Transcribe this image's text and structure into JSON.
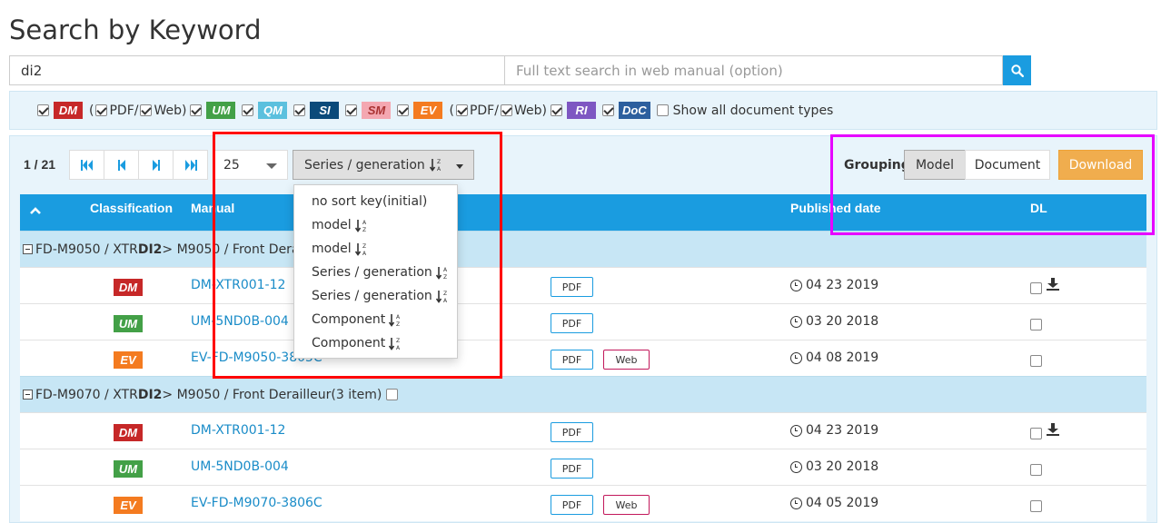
{
  "page": {
    "title": "Search by Keyword"
  },
  "search": {
    "keyword_value": "di2",
    "fulltext_placeholder": "Full text search in web manual (option)",
    "search_icon": "search-icon"
  },
  "filters": {
    "items": [
      {
        "code": "DM",
        "color": "#c62828",
        "checked": true
      },
      {
        "code": "UM",
        "color": "#43a047",
        "checked": true
      },
      {
        "code": "QM",
        "color": "#5bc0de",
        "checked": true
      },
      {
        "code": "SI",
        "color": "#0b4a7a",
        "checked": true
      },
      {
        "code": "SM",
        "color": "#f4a7b1",
        "checked": true
      },
      {
        "code": "EV",
        "color": "#f47b20",
        "checked": true
      },
      {
        "code": "RI",
        "color": "#7e57c2",
        "checked": true
      },
      {
        "code": "DoC",
        "color": "#2c5f9e",
        "checked": true
      }
    ],
    "open_paren": "(",
    "close_paren": ")",
    "pdf_label": "PDF",
    "slash": "/",
    "web_label": "Web",
    "show_all_label": "Show all document types"
  },
  "pager": {
    "count": "1 / 21",
    "per_page": "25"
  },
  "sort": {
    "selected": "Series / generation",
    "options": [
      {
        "label": "no sort key(initial)",
        "icon": ""
      },
      {
        "label": "model",
        "icon": "sort-asc-icon"
      },
      {
        "label": "model",
        "icon": "sort-desc-icon"
      },
      {
        "label": "Series / generation",
        "icon": "sort-asc-icon"
      },
      {
        "label": "Series / generation",
        "icon": "sort-desc-icon"
      },
      {
        "label": "Component",
        "icon": "sort-asc-icon"
      },
      {
        "label": "Component",
        "icon": "sort-desc-icon"
      }
    ]
  },
  "grouping": {
    "label": "Grouping",
    "model": "Model",
    "document": "Document"
  },
  "download_label": "Download",
  "table": {
    "headers": {
      "classification": "Classification",
      "manual": "Manual",
      "published": "Published date",
      "dl": "DL"
    },
    "groups": [
      {
        "prefix": "FD-M9050 / XTR ",
        "bold": "DI2",
        "suffix": " > M9050 / Front Derailleur(3 item)",
        "rows": [
          {
            "code": "DM",
            "color": "#c62828",
            "manual": "DM-XTR001-12",
            "pdf": "PDF",
            "web": "",
            "date": "04 23 2019",
            "download": true
          },
          {
            "code": "UM",
            "color": "#43a047",
            "manual": "UM-5ND0B-004",
            "pdf": "PDF",
            "web": "",
            "date": "03 20 2018",
            "download": false
          },
          {
            "code": "EV",
            "color": "#f47b20",
            "manual": "EV-FD-M9050-3805C",
            "pdf": "PDF",
            "web": "Web",
            "date": "04 08 2019",
            "download": false
          }
        ]
      },
      {
        "prefix": "FD-M9070 / XTR ",
        "bold": "DI2",
        "suffix": " > M9050 / Front Derailleur(3 item)",
        "rows": [
          {
            "code": "DM",
            "color": "#c62828",
            "manual": "DM-XTR001-12",
            "pdf": "PDF",
            "web": "",
            "date": "04 23 2019",
            "download": true
          },
          {
            "code": "UM",
            "color": "#43a047",
            "manual": "UM-5ND0B-004",
            "pdf": "PDF",
            "web": "",
            "date": "03 20 2018",
            "download": false
          },
          {
            "code": "EV",
            "color": "#f47b20",
            "manual": "EV-FD-M9070-3806C",
            "pdf": "PDF",
            "web": "Web",
            "date": "04 05 2019",
            "download": false
          }
        ]
      }
    ]
  }
}
